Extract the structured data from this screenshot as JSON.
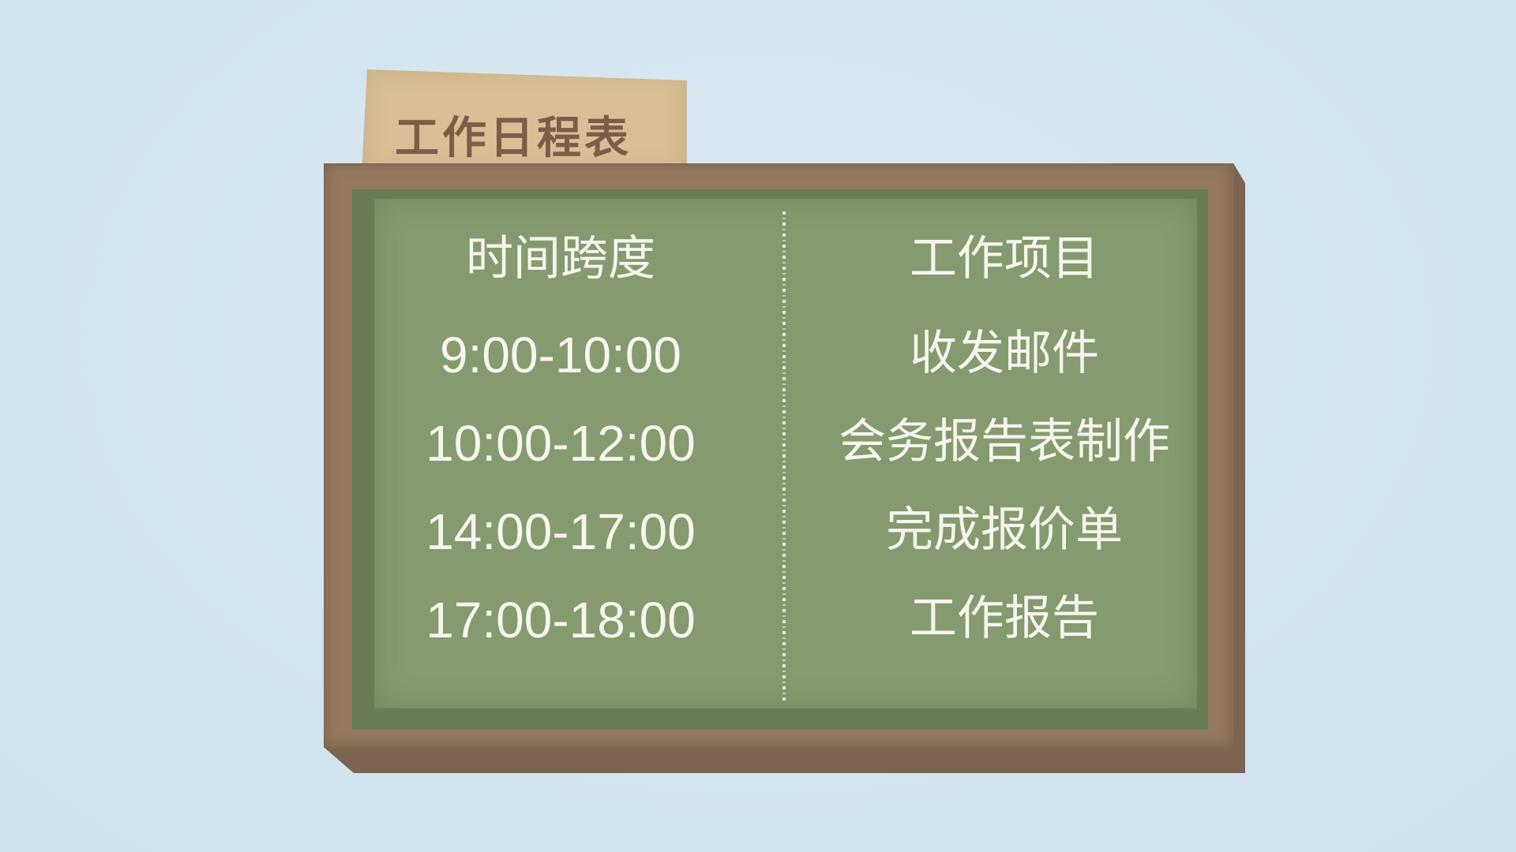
{
  "tag": {
    "title": "工作日程表"
  },
  "table": {
    "headers": {
      "time": "时间跨度",
      "task": "工作项目"
    },
    "rows": [
      {
        "time": "9:00-10:00",
        "task": "收发邮件"
      },
      {
        "time": "10:00-12:00",
        "task": "会务报告表制作"
      },
      {
        "time": "14:00-17:00",
        "task": "完成报价单"
      },
      {
        "time": "17:00-18:00",
        "task": "工作报告"
      }
    ]
  },
  "colors": {
    "background": "#d4e6f0",
    "tag": "#d8bf96",
    "tag_text": "#7a5f47",
    "frame": "#957a5f",
    "board": "#869a6f",
    "chalk": "#f6f6ef"
  }
}
